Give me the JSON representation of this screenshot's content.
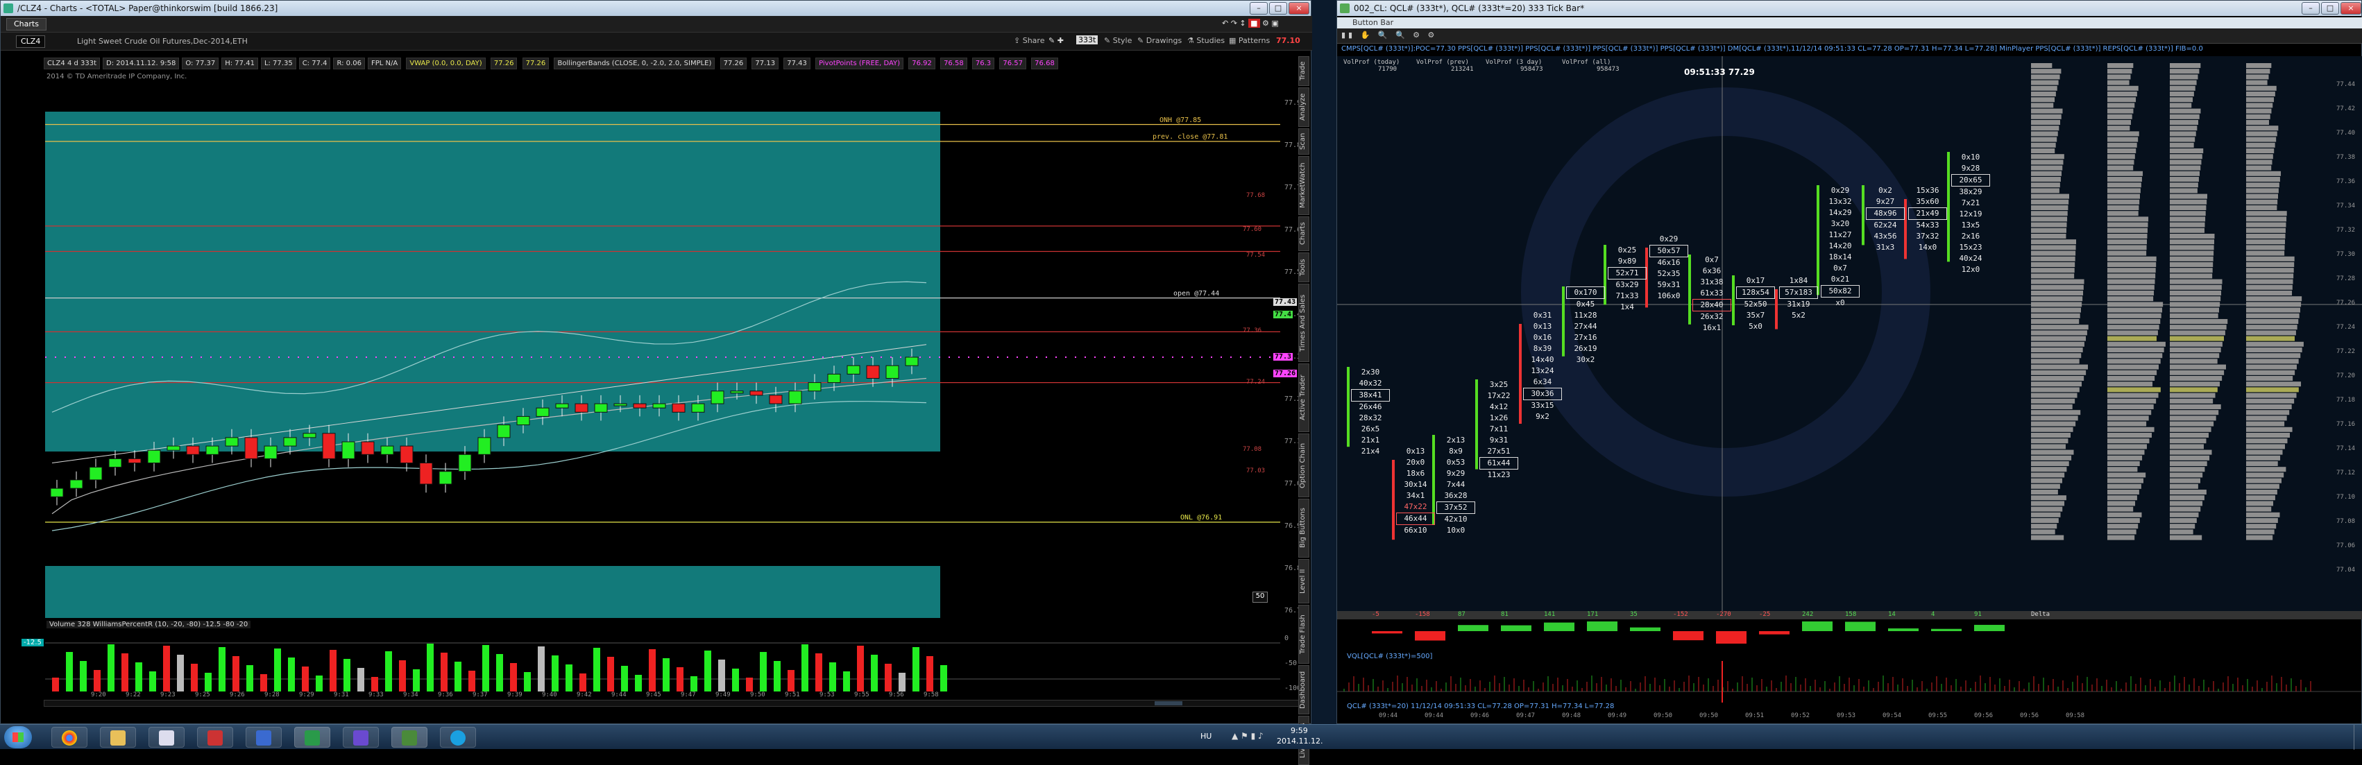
{
  "left_window": {
    "title": "/CLZ4 - Charts - <TOTAL> Paper@thinkorswim [build 1866.23]",
    "tab_label": "Charts",
    "symbol": "CLZ4",
    "description": "Light Sweet Crude Oil Futures,Dec-2014,ETH",
    "toolbar": {
      "share": "Share",
      "timeframe": "333t",
      "style": "Style",
      "drawings": "Drawings",
      "studies": "Studies",
      "patterns": "Patterns",
      "last": "77.10"
    },
    "quote_line": [
      "CLZ4 4 d 333t",
      "D: 2014.11.12. 9:58",
      "O: 77.37",
      "H: 77.41",
      "L: 77.35",
      "C: 77.4",
      "R: 0.06",
      "FPL N/A"
    ],
    "vwap_label": "VWAP (0.0, 0.0, DAY)",
    "vwap_vals": [
      "77.26",
      "77.26"
    ],
    "bb_label": "BollingerBands (CLOSE, 0, -2.0, 2.0, SIMPLE)",
    "bb_vals": [
      "77.26",
      "77.13",
      "77.43"
    ],
    "pivots_label": "PivotPoints (FREE, DAY)",
    "pivots_vals": [
      "76.92",
      "76.58",
      "76.3",
      "76.57",
      "76.68"
    ],
    "copyright": "2014 © TD Ameritrade IP Company, Inc.",
    "price_lines": [
      {
        "label": "ONH @77.85",
        "color": "#e8c04a"
      },
      {
        "label": "prev. close @77.81",
        "color": "#e8c04a"
      },
      {
        "label": "open @77.44",
        "color": "#dddddd"
      },
      {
        "label": "ONL @76.91",
        "color": "#e8e84a"
      }
    ],
    "right_axis": [
      "77.9",
      "77.8",
      "77.7",
      "77.6",
      "77.5",
      "77.4",
      "77.3",
      "77.2",
      "77.1",
      "77.0",
      "76.9",
      "76.8",
      "76.7"
    ],
    "axis_badges": [
      {
        "text": "77.43",
        "color": "#ddd"
      },
      {
        "text": "77.4",
        "color": "#44dd44"
      },
      {
        "text": "77.3",
        "color": "#ff44ff"
      },
      {
        "text": "77.26",
        "color": "#ff44ff"
      }
    ],
    "small_level_labels": [
      "77.68",
      "77.60",
      "77.54",
      "77.36",
      "77.24",
      "77.08",
      "77.03"
    ],
    "lower_pane_label": "Volume 328 WilliamsPercentR (10, -20, -80) -12.5 -80 -20",
    "wpr_axis": [
      "0",
      "-50",
      "-100"
    ],
    "wpr_badge": "-12.5",
    "bottom_times": [
      "9:20",
      "9:22",
      "9:23",
      "9:25",
      "9:26",
      "9:28",
      "9:29",
      "9:31",
      "9:33",
      "9:34",
      "9:36",
      "9:37",
      "9:39",
      "9:40",
      "9:42",
      "9:44",
      "9:45",
      "9:47",
      "9:49",
      "9:50",
      "9:51",
      "9:53",
      "9:55",
      "9:56",
      "9:58"
    ],
    "scroll_box": "50",
    "side_tabs": [
      "Trade",
      "Analyze",
      "Scan",
      "MarketWatch",
      "Charts",
      "Tools",
      "Times And Sales",
      "Active Trader",
      "Option Chain",
      "Big Buttons",
      "Level II",
      "Trade Flash",
      "Dashboard",
      "Live News"
    ]
  },
  "right_window": {
    "title": "002_CL: QCL# (333t*), QCL# (333t*=20) 333 Tick Bar*",
    "button_bar": "Button Bar",
    "header_line": "CMPS[QCL# (333t*)]:POC=77.30   PPS[QCL# (333t*)]   PPS[QCL# (333t*)]   PPS[QCL# (333t*)]   PPS[QCL# (333t*)]   DM[QCL# (333t*),11/12/14 09:51:33 CL=77.28 OP=77.31 H=77.34 L=77.28]   MinPlayer   PPS[QCL# (333t*)]   REPS[QCL# (333t*)] FIB=0.0",
    "crosshair": "09:51:33 77.29",
    "vp_headers": [
      {
        "title": "VolProf (today)",
        "value": "71790"
      },
      {
        "title": "VolProf (prev)",
        "value": "213241"
      },
      {
        "title": "VolProf (3 day)",
        "value": "958473"
      },
      {
        "title": "VolProf (all)",
        "value": "958473"
      }
    ],
    "price_axis": [
      "77.44",
      "77.42",
      "77.40",
      "77.38",
      "77.36",
      "77.34",
      "77.32",
      "77.30",
      "77.28",
      "77.26",
      "77.24",
      "77.22",
      "77.20",
      "77.18",
      "77.16",
      "77.14",
      "77.12",
      "77.10",
      "77.08",
      "77.06",
      "77.04"
    ],
    "footprint": [
      {
        "cells": [
          "2x30",
          "40x32",
          "38x41",
          "26x46",
          "28x32",
          "26x5",
          "21x1",
          "21x4"
        ],
        "boxed": [
          2
        ]
      },
      {
        "cells": [
          "0x13",
          "20x0",
          "18x6",
          "30x14",
          "34x1",
          "47x22",
          "46x44",
          "66x10"
        ],
        "boxed": [
          6
        ],
        "red": [
          5,
          6
        ]
      },
      {
        "cells": [
          "2x13",
          "8x9",
          "0x53",
          "9x29",
          "7x44",
          "36x28",
          "37x52",
          "42x10",
          "10x0"
        ],
        "boxed": [
          6
        ]
      },
      {
        "cells": [
          "3x25",
          "17x22",
          "4x12",
          "1x26",
          "7x11",
          "9x31",
          "27x51",
          "61x44",
          "11x23"
        ],
        "boxed": [
          7
        ]
      },
      {
        "cells": [
          "0x31",
          "0x13",
          "0x16",
          "8x39",
          "14x40",
          "13x24",
          "6x34",
          "30x36",
          "33x15",
          "9x2"
        ],
        "boxed": [
          7
        ]
      },
      {
        "cells": [
          "0x170",
          "0x45",
          "11x28",
          "27x44",
          "27x16",
          "26x19",
          "30x2"
        ],
        "boxed": [
          0
        ]
      },
      {
        "cells": [
          "0x25",
          "9x89",
          "52x71",
          "63x29",
          "71x33",
          "1x4"
        ],
        "boxed": [
          2
        ]
      },
      {
        "cells": [
          "0x29",
          "50x57",
          "46x16",
          "52x35",
          "59x31",
          "106x0"
        ],
        "boxed": [
          1
        ]
      },
      {
        "cells": [
          "0x7",
          "6x36",
          "31x38",
          "61x33",
          "28x40",
          "26x32",
          "16x1"
        ],
        "boxed": [
          4
        ],
        "red": [
          4
        ]
      },
      {
        "cells": [
          "0x17",
          "128x54",
          "52x50",
          "35x7",
          "5x0"
        ],
        "boxed": [
          1
        ]
      },
      {
        "cells": [
          "1x84",
          "57x183",
          "31x19",
          "5x2"
        ],
        "boxed": [
          1
        ]
      },
      {
        "cells": [
          "0x29",
          "13x32",
          "14x29",
          "3x20",
          "11x27",
          "14x20",
          "18x14",
          "0x7",
          "0x21",
          "50x82",
          "x0"
        ],
        "boxed": [
          9
        ]
      },
      {
        "cells": [
          "0x2",
          "9x27",
          "48x96",
          "62x24",
          "43x56",
          "31x3"
        ],
        "boxed": [
          2
        ]
      },
      {
        "cells": [
          "15x36",
          "35x60",
          "21x49",
          "54x33",
          "37x32",
          "14x0"
        ],
        "boxed": [
          2
        ]
      },
      {
        "cells": [
          "0x10",
          "9x28",
          "20x65",
          "38x29",
          "7x21",
          "12x19",
          "13x5",
          "2x16",
          "15x23",
          "40x24",
          "12x0"
        ],
        "boxed": [
          2
        ]
      }
    ],
    "delta_label": "Delta",
    "delta_values": [
      "-5",
      "-158",
      "87",
      "81",
      "141",
      "171",
      "35",
      "-152",
      "-270",
      "-25",
      "242",
      "158",
      "14",
      "4",
      "91"
    ],
    "sub_pane1": "VQL[QCL# (333t*)=500]",
    "sub_pane2": "QCL# (333t*=20) 11/12/14 09:51:33 CL=77.28 OP=77.31 H=77.34 L=77.28",
    "times": [
      "09:44",
      "09:44",
      "09:46",
      "09:47",
      "09:48",
      "09:49",
      "09:50",
      "09:50",
      "09:51",
      "09:52",
      "09:53",
      "09:54",
      "09:55",
      "09:56",
      "09:56",
      "09:58"
    ]
  },
  "taskbar": {
    "language": "HU",
    "time": "9:59",
    "date": "2014.11.12."
  }
}
